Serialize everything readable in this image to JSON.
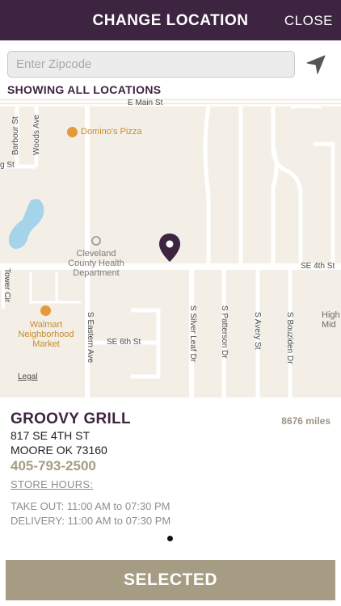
{
  "header": {
    "title": "CHANGE LOCATION",
    "close_label": "CLOSE"
  },
  "search": {
    "placeholder": "Enter Zipcode",
    "value": "",
    "locate_icon": "navigation-arrow-icon"
  },
  "showing_label": "SHOWING ALL LOCATIONS",
  "map": {
    "streets": {
      "e_main": "E Main St",
      "se_4th": "SE 4th St",
      "se_6th": "SE 6th St",
      "barbour": "Barbour St",
      "woods": "Woods Ave",
      "tower": "Tower Cir",
      "s_eastern": "S Eastern Ave",
      "s_silver_leaf": "S Silver Leaf Dr",
      "s_patterson": "S Patterson Dr",
      "s_avery": "S Avery St",
      "s_bouziden": "S Bouziden Dr",
      "g_st": "g St",
      "high_mid": "High Mid"
    },
    "pois": {
      "dominos": "Domino's Pizza",
      "cleveland_health": "Cleveland County Health Department",
      "walmart": "Walmart Neighborhood Market"
    },
    "legal": "Legal",
    "colors": {
      "land": "#f3efe6",
      "road": "#ffffff",
      "water": "#a5d3ea",
      "pin": "#3d2440",
      "poi": "#e39a3b"
    }
  },
  "store": {
    "name": "GROOVY GRILL",
    "distance": "8676 miles",
    "address_line1": "817 SE 4TH ST",
    "address_line2": "MOORE OK 73160",
    "phone": "405-793-2500",
    "hours_link": "STORE HOURS:",
    "takeout": "TAKE OUT: 11:00 AM to 07:30 PM",
    "delivery": "DELIVERY: 11:00 AM to 07:30 PM"
  },
  "pager": {
    "current": 1,
    "total": 1
  },
  "action": {
    "selected_label": "SELECTED"
  },
  "theme": {
    "header": "#3d2440",
    "accent": "#a69c83"
  }
}
